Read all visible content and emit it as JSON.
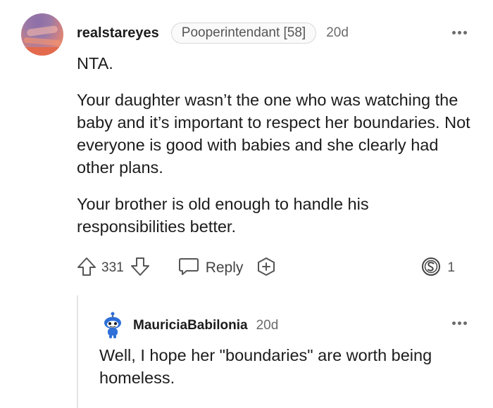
{
  "comment": {
    "username": "realstareyes",
    "flair": "Pooperintendant [58]",
    "time": "20d",
    "paragraphs": [
      "NTA.",
      "Your daughter wasn’t the one who was watching the baby and it’s important to respect her boundaries. Not everyone is good with babies and she clearly had other plans.",
      "Your brother is old enough to handle his responsibilities better."
    ],
    "vote_count": "331",
    "reply_label": "Reply",
    "award_count": "1"
  },
  "reply": {
    "username": "MauriciaBabilonia",
    "time": "20d",
    "text": "Well, I hope her \"boundaries\" are worth being homeless."
  },
  "icons": {
    "more": "more-options-icon",
    "upvote": "upvote-arrow-icon",
    "downvote": "downvote-arrow-icon",
    "reply": "speech-bubble-icon",
    "award": "add-award-icon",
    "coin": "coin-s-icon"
  },
  "colors": {
    "text": "#1c1c1c",
    "meta": "#6b6b6b",
    "icon": "#555555",
    "snoo_blue": "#2e6fd8"
  }
}
